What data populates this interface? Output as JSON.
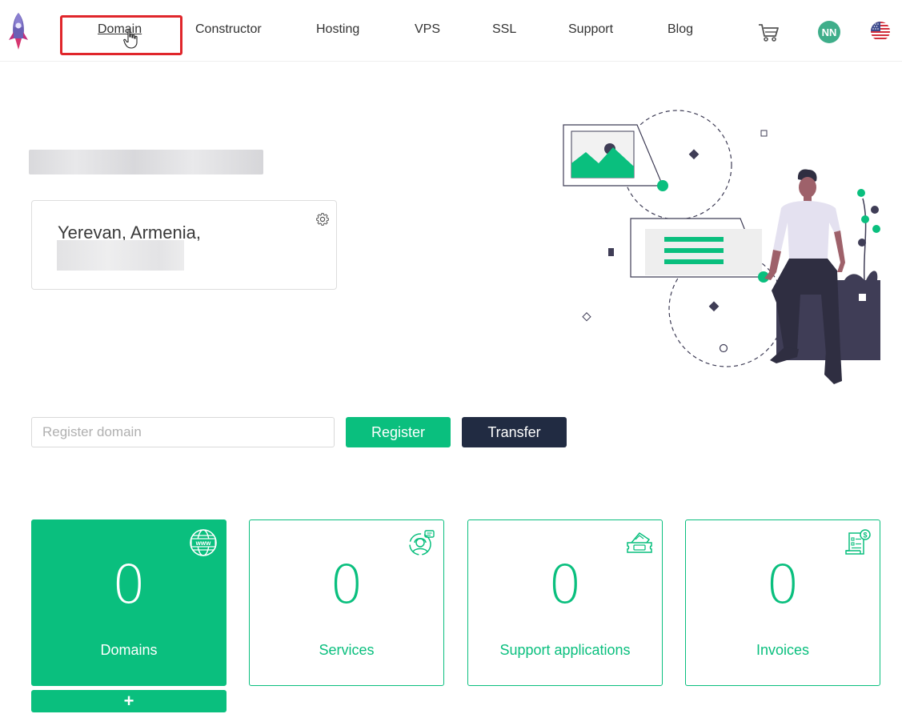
{
  "nav": {
    "items": [
      {
        "label": "Domain",
        "active": true
      },
      {
        "label": "Constructor"
      },
      {
        "label": "Hosting"
      },
      {
        "label": "VPS"
      },
      {
        "label": "SSL"
      },
      {
        "label": "Support"
      },
      {
        "label": "Blog"
      }
    ],
    "user_initials": "NN",
    "cart_icon": "cart-icon",
    "flag_icon": "us-flag-icon"
  },
  "profile": {
    "address_line1": "Yerevan, Armenia,"
  },
  "domain_search": {
    "placeholder": "Register domain",
    "register_label": "Register",
    "transfer_label": "Transfer"
  },
  "stats": [
    {
      "count": "0",
      "label": "Domains",
      "icon": "globe-www-icon"
    },
    {
      "count": "0",
      "label": "Services",
      "icon": "support-agent-icon"
    },
    {
      "count": "0",
      "label": "Support applications",
      "icon": "ticket-icon"
    },
    {
      "count": "0",
      "label": "Invoices",
      "icon": "invoice-icon"
    }
  ],
  "add_domain_label": "+",
  "colors": {
    "accent": "#0abf7e",
    "dark": "#212b42",
    "highlight": "#e0262b",
    "avatar": "#3fae8a"
  }
}
